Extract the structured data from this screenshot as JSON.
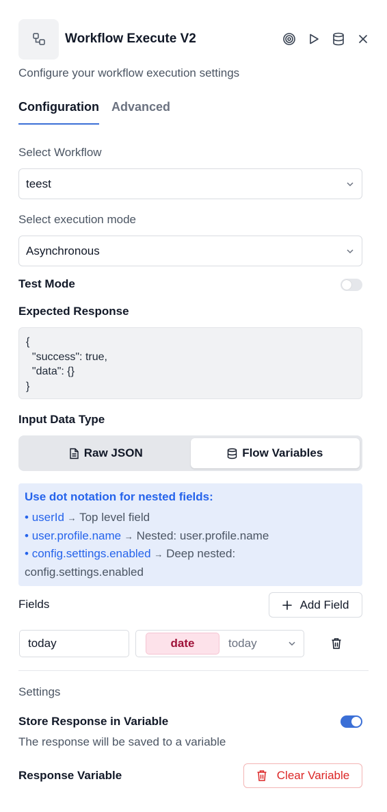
{
  "header": {
    "title": "Workflow Execute V2",
    "subtitle": "Configure your workflow execution settings",
    "actions": [
      "target-icon",
      "play-icon",
      "database-icon",
      "close-icon"
    ]
  },
  "tabs": [
    {
      "label": "Configuration",
      "active": true
    },
    {
      "label": "Advanced",
      "active": false
    }
  ],
  "workflow": {
    "label": "Select Workflow",
    "value": "teest"
  },
  "execution_mode": {
    "label": "Select execution mode",
    "value": "Asynchronous"
  },
  "test_mode": {
    "label": "Test Mode",
    "enabled": false
  },
  "expected_response": {
    "label": "Expected Response",
    "code": "{\n  \"success\": true,\n  \"data\": {}\n}"
  },
  "input_data_type": {
    "label": "Input Data Type",
    "options": [
      "Raw JSON",
      "Flow Variables"
    ],
    "selected": "Flow Variables"
  },
  "info": {
    "title": "Use dot notation for nested fields:",
    "items": [
      {
        "key": "userId",
        "desc": "Top level field"
      },
      {
        "key": "user.profile.name",
        "desc": "Nested: user.profile.name"
      },
      {
        "key": "config.settings.enabled",
        "desc": "Deep nested:",
        "desc2": "config.settings.enabled"
      }
    ],
    "bullet": "•",
    "arrow": "→"
  },
  "fields": {
    "label": "Fields",
    "add_label": "Add Field",
    "rows": [
      {
        "name": "today",
        "type": "date",
        "variable": "today"
      }
    ]
  },
  "settings": {
    "label": "Settings",
    "store_label": "Store Response in Variable",
    "store_enabled": true,
    "store_help": "The response will be saved to a variable",
    "response_variable_label": "Response Variable",
    "clear_label": "Clear Variable"
  },
  "colors": {
    "accent": "#3b6fd6",
    "info_bg": "#e6edfb",
    "info_text": "#2563eb",
    "badge_bg": "#fde2ea",
    "badge_text": "#9f1239",
    "danger": "#dc2626"
  }
}
